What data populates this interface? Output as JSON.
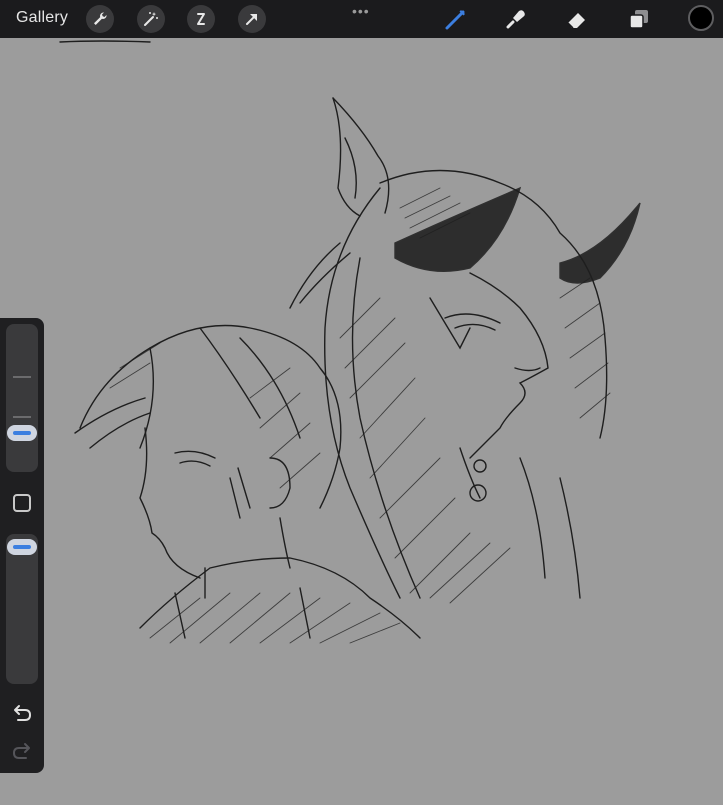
{
  "topbar": {
    "gallery_label": "Gallery",
    "left_buttons": [
      "wrench-icon",
      "magic-wand-icon",
      "selection-icon",
      "transform-arrow-icon"
    ],
    "more_label": "•••",
    "right_tools": [
      "brush-icon",
      "smudge-icon",
      "eraser-icon",
      "layers-icon"
    ],
    "active_tool": "brush-icon",
    "current_color": "#000000",
    "accent_color": "#3c7fe0"
  },
  "sidebar": {
    "brush_size_level": 0.38,
    "opacity_level": 1.0,
    "buttons": [
      "modify-square-icon",
      "undo-icon",
      "redo-icon"
    ]
  },
  "canvas": {
    "background_color": "#9c9c9c",
    "content": "sketch-drawing"
  }
}
